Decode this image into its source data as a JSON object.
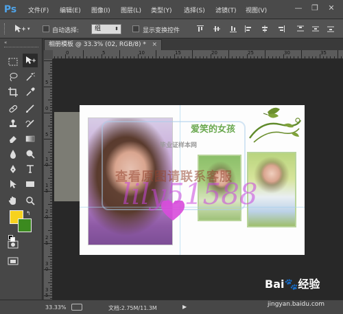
{
  "app": {
    "logo": "Ps"
  },
  "menu": {
    "items": [
      {
        "label": "文件(F)"
      },
      {
        "label": "编辑(E)"
      },
      {
        "label": "图像(I)"
      },
      {
        "label": "图层(L)"
      },
      {
        "label": "类型(Y)"
      },
      {
        "label": "选择(S)"
      },
      {
        "label": "滤镜(T)"
      },
      {
        "label": "视图(V)"
      }
    ]
  },
  "window_controls": {
    "minimize": "—",
    "restore": "❐",
    "close": "✕"
  },
  "options": {
    "auto_select_label": "自动选择:",
    "auto_select_value": "组",
    "show_transform_label": "显示变换控件"
  },
  "document": {
    "tab_title": "相册模板 @ 33.3% (02, RGB/8) *",
    "tab_close": "×",
    "canvas_title": "爱笑的女孩"
  },
  "rulers": {
    "top": [
      "0",
      "5",
      "10",
      "15",
      "20",
      "25",
      "30",
      "35"
    ],
    "left": [
      "5",
      "0",
      "5",
      "1 0",
      "1 5",
      "2 0",
      "2 5",
      "3 0",
      "3 5"
    ]
  },
  "watermarks": {
    "logo_text": "毕业证样本网",
    "red_text": "查看原图请联系客服",
    "purple_text": "lily51588"
  },
  "status": {
    "zoom": "33.33%",
    "doc_label": "文档:2.75M/11.3M"
  },
  "baidu": {
    "logo": "Bai",
    "logo_suffix": "经验",
    "url": "jingyan.baidu.com"
  },
  "colors": {
    "foreground": "#f7d21e",
    "background": "#3b8a1f",
    "accent": "#4fa3e8"
  },
  "icons": [
    "move-tool-icon",
    "marquee-tool-icon",
    "artboard-tool-icon",
    "lasso-tool-icon",
    "magic-wand-tool-icon",
    "crop-tool-icon",
    "eyedropper-tool-icon",
    "healing-brush-tool-icon",
    "brush-tool-icon",
    "clone-stamp-tool-icon",
    "history-brush-tool-icon",
    "eraser-tool-icon",
    "gradient-tool-icon",
    "blur-tool-icon",
    "dodge-tool-icon",
    "pen-tool-icon",
    "type-tool-icon",
    "path-select-tool-icon",
    "rectangle-tool-icon",
    "hand-tool-icon",
    "zoom-tool-icon"
  ]
}
